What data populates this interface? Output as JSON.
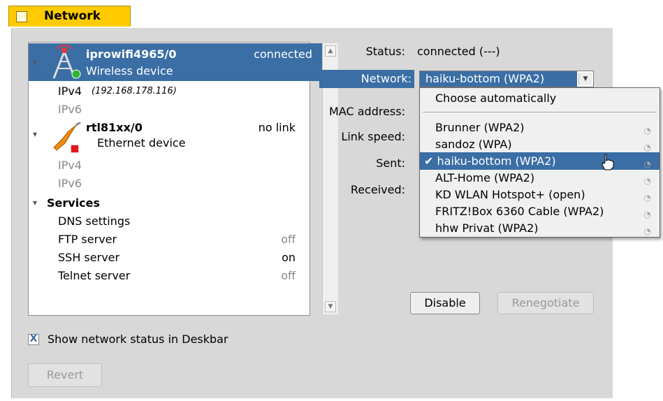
{
  "window": {
    "title": "Network"
  },
  "interfaces": [
    {
      "name": "iprowifi4965/0",
      "state": "connected",
      "type": "Wireless device",
      "ipv4_label": "IPv4",
      "ipv4_addr": "(192.168.178.116)",
      "ipv6_label": "IPv6"
    },
    {
      "name": "rtl81xx/0",
      "state": "no link",
      "type": "Ethernet device",
      "ipv4_label": "IPv4",
      "ipv6_label": "IPv6"
    }
  ],
  "services": {
    "header": "Services",
    "items": [
      {
        "name": "DNS settings",
        "state": ""
      },
      {
        "name": "FTP server",
        "state": "off"
      },
      {
        "name": "SSH server",
        "state": "on"
      },
      {
        "name": "Telnet server",
        "state": "off"
      }
    ]
  },
  "details": {
    "status_label": "Status:",
    "status_value": "connected (---)",
    "network_label": "Network:",
    "network_value": "haiku-bottom (WPA2)",
    "mac_label": "MAC address:",
    "speed_label": "Link speed:",
    "sent_label": "Sent:",
    "received_label": "Received:"
  },
  "network_menu": {
    "auto": "Choose automatically",
    "items": [
      "Brunner (WPA2)",
      "sandoz (WPA)",
      "haiku-bottom (WPA2)",
      "ALT-Home (WPA2)",
      "KD WLAN Hotspot+ (open)",
      "FRITZ!Box 6360 Cable (WPA2)",
      "hhw Privat (WPA2)"
    ],
    "selected": "haiku-bottom (WPA2)",
    "check_mark": "✔",
    "signal_icon": "wifi-signal-icon"
  },
  "buttons": {
    "disable": "Disable",
    "renegotiate": "Renegotiate",
    "revert": "Revert"
  },
  "deskbar": {
    "label": "Show network status in Deskbar",
    "checked": true,
    "mark": "X"
  },
  "colors": {
    "tab": "#ffcb00",
    "selection": "#3a6ea5",
    "panel": "#d8d8d8"
  }
}
